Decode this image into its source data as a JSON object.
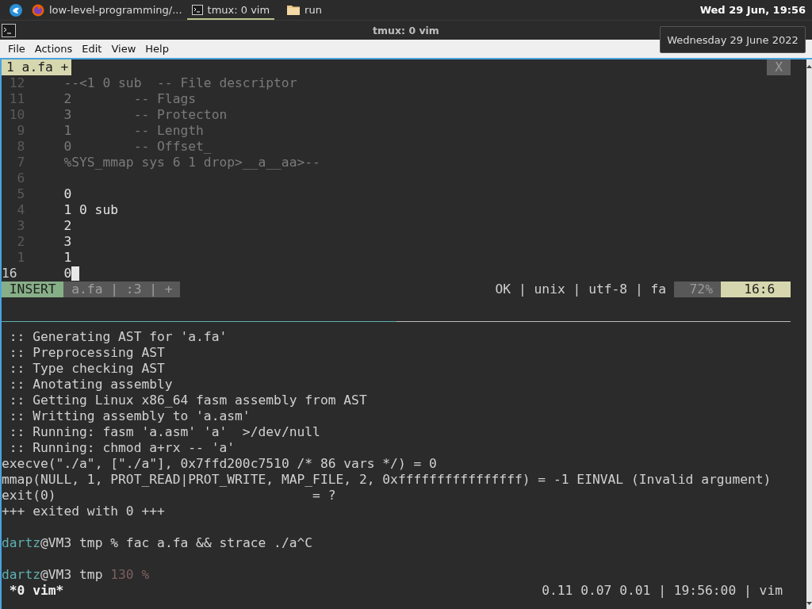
{
  "taskbar": {
    "items": [
      {
        "label": "low-level-programming/...",
        "kind": "browser",
        "selected": false
      },
      {
        "label": "tmux: 0 vim",
        "kind": "terminal",
        "selected": true
      },
      {
        "label": "run",
        "kind": "folder",
        "selected": false
      }
    ],
    "clock": "Wed 29 Jun, 19:56"
  },
  "tooltip": "Wednesday 29 June 2022",
  "window": {
    "title": "tmux: 0 vim",
    "menu": [
      "File",
      "Actions",
      "Edit",
      "View",
      "Help"
    ]
  },
  "vim": {
    "tab": "1 a.fa +",
    "close": "X",
    "lines": [
      {
        "number": "12",
        "text": "--<1 0 sub  -- File descriptor",
        "dimmed": true,
        "current": false
      },
      {
        "number": "11",
        "text": "2        -- Flags",
        "dimmed": true,
        "current": false
      },
      {
        "number": "10",
        "text": "3        -- Protecton",
        "dimmed": true,
        "current": false
      },
      {
        "number": "9",
        "text": "1        -- Length",
        "dimmed": true,
        "current": false
      },
      {
        "number": "8",
        "text": "0        -- Offset_",
        "dimmed": true,
        "current": false
      },
      {
        "number": "7",
        "text": "%SYS_mmap sys 6 1 drop>__a__aa>--",
        "dimmed": true,
        "current": false
      },
      {
        "number": "6",
        "current": false
      },
      {
        "number": "5",
        "text": "0",
        "dimmed": false,
        "current": false
      },
      {
        "number": "4",
        "text": "1 0 sub",
        "dimmed": false,
        "current": false
      },
      {
        "number": "3",
        "text": "2",
        "dimmed": false,
        "current": false
      },
      {
        "number": "2",
        "text": "3",
        "dimmed": false,
        "current": false
      },
      {
        "number": "1",
        "text": "1",
        "dimmed": false,
        "current": false
      },
      {
        "number": "16",
        "text": "0",
        "dimmed": false,
        "current": true
      }
    ],
    "status": {
      "mode": "INSERT",
      "file": "a.fa | :3 | +",
      "info": "OK | unix | utf-8 | fa",
      "percent": "72%",
      "position": "16:6"
    }
  },
  "output": [
    " :: Generating AST for 'a.fa'",
    " :: Preprocessing AST",
    " :: Type checking AST",
    " :: Anotating assembly",
    " :: Getting Linux x86_64 fasm assembly from AST",
    " :: Writting assembly to 'a.asm'",
    " :: Running: fasm 'a.asm' 'a'  >/dev/null",
    " :: Running: chmod a+rx -- 'a'",
    "execve(\"./a\", [\"./a\"], 0x7ffd200c7510 /* 86 vars */) = 0",
    "mmap(NULL, 1, PROT_READ|PROT_WRITE, MAP_FILE, 2, 0xffffffffffffffff) = -1 EINVAL (Invalid argument)",
    "exit(0)                                 = ?",
    "+++ exited with 0 +++"
  ],
  "prompts": [
    {
      "user": "dartz",
      "host": "@VM3 tmp",
      "symbol": "%",
      "command": "fac a.fa && strace ./a^C"
    },
    {
      "user": "dartz",
      "host": "@VM3 tmp",
      "exit_code": "130",
      "symbol": "%"
    }
  ],
  "tmux": {
    "window": "*0 vim*",
    "info": "0.11 0.07 0.01 | 19:56:00 | vim"
  }
}
